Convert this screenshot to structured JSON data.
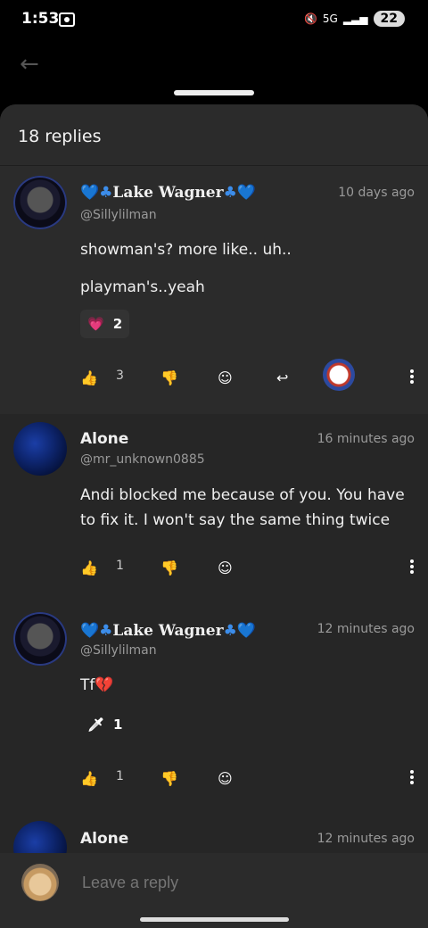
{
  "status": {
    "time": "1:53",
    "battery": "22",
    "network": "5G"
  },
  "sheet": {
    "title": "18 replies"
  },
  "comments": [
    {
      "name_prefix": "💙♣",
      "name": "Lake Wagner",
      "name_suffix": "♣💙",
      "handle": "@Sillylilman",
      "time": "10 days ago",
      "lines": [
        "showman's? more like.. uh..",
        "playman's..yeah"
      ],
      "reaction": {
        "emoji": "💗",
        "count": "2"
      },
      "likes": "3"
    },
    {
      "name": "Alone",
      "handle": "@mr_unknown0885",
      "time": "16 minutes ago",
      "text": "Andi blocked me because of you. You have to fix it. I won't say the same thing twice",
      "likes": "1"
    },
    {
      "name_prefix": "💙♣",
      "name": "Lake Wagner",
      "name_suffix": "♣💙",
      "handle": "@Sillylilman",
      "time": "12 minutes ago",
      "text": "Tf💔",
      "reaction": {
        "emoji": "🗡",
        "count": "1"
      },
      "likes": "1"
    },
    {
      "name": "Alone",
      "time": "12 minutes ago"
    }
  ],
  "reply": {
    "placeholder": "Leave a reply"
  }
}
